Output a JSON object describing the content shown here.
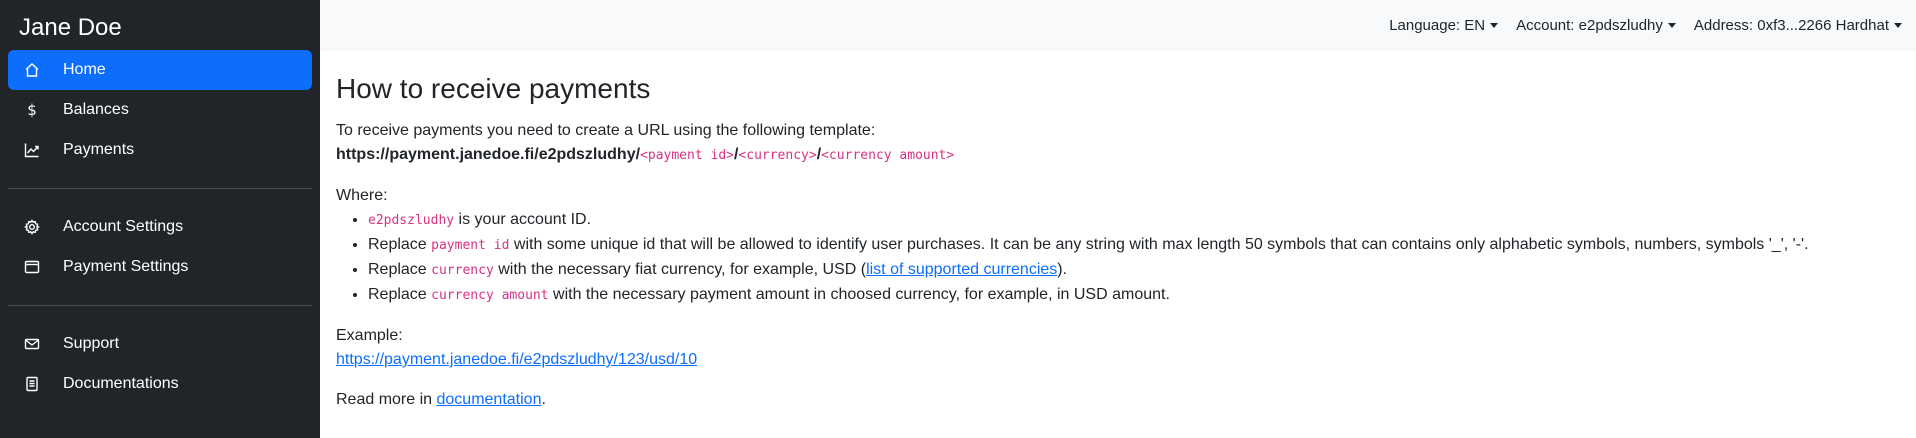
{
  "brand": "Jane Doe",
  "sidebar": {
    "primary": [
      {
        "label": "Home",
        "icon": "home-icon",
        "active": true
      },
      {
        "label": "Balances",
        "icon": "dollar-icon"
      },
      {
        "label": "Payments",
        "icon": "chart-line-icon"
      }
    ],
    "settings": [
      {
        "label": "Account Settings",
        "icon": "gear-icon"
      },
      {
        "label": "Payment Settings",
        "icon": "window-icon"
      }
    ],
    "help": [
      {
        "label": "Support",
        "icon": "envelope-icon"
      },
      {
        "label": "Documentations",
        "icon": "document-icon"
      }
    ]
  },
  "topbar": {
    "language": "Language: EN",
    "account": "Account: e2pdszludhy",
    "address": "Address: 0xf3...2266 Hardhat"
  },
  "main": {
    "title": "How to receive payments",
    "intro": "To receive payments you need to create a URL using the following template:",
    "template_base": "https://payment.janedoe.fi/e2pdszludhy/",
    "template_payment_id": "<payment id>",
    "slash": "/",
    "template_currency": "<currency>",
    "template_amount": "<currency amount>",
    "where_label": "Where:",
    "where_items": {
      "account": {
        "code": "e2pdszludhy",
        "text": " is your account ID."
      },
      "payment_id": {
        "prefix": "Replace ",
        "code": "payment id",
        "text": " with some unique id that will be allowed to identify user purchases. It can be any string with max length 50 symbols that can contains only alphabetic symbols, numbers, symbols '_', '-'."
      },
      "currency": {
        "prefix": "Replace ",
        "code": "currency",
        "text": " with the necessary fiat currency, for example, USD (",
        "link": "list of supported currencies",
        "suffix": ")."
      },
      "amount": {
        "prefix": "Replace ",
        "code": "currency amount",
        "text": " with the necessary payment amount in choosed currency, for example, in USD amount."
      }
    },
    "example_label": "Example:",
    "example_link": "https://payment.janedoe.fi/e2pdszludhy/123/usd/10",
    "read_more_prefix": "Read more in ",
    "read_more_link": "documentation",
    "read_more_suffix": "."
  },
  "colors": {
    "sidebar_bg": "#212529",
    "active_bg": "#0d6efd",
    "code": "#d63384",
    "link": "#0d6efd",
    "topbar_bg": "#f8f9fa"
  }
}
